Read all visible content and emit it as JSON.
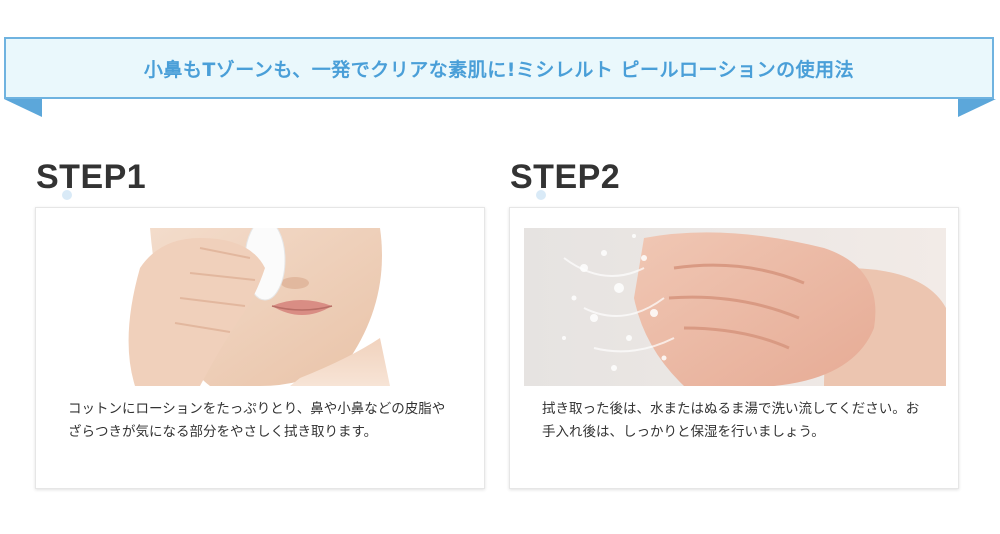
{
  "banner": {
    "title": "小鼻もTゾーンも、一発でクリアな素肌に!ミシレルト ピールローションの使用法"
  },
  "steps": [
    {
      "heading": "STEP1",
      "text": "コットンにローションをたっぷりとり、鼻や小鼻などの皮脂やざらつきが気になる部分をやさしく拭き取ります。",
      "image": "woman-applying-cotton-pad-photo"
    },
    {
      "heading": "STEP2",
      "text": "拭き取った後は、水またはぬるま湯で洗い流してください。お手入れ後は、しっかりと保湿を行いましょう。",
      "image": "face-splashing-water-photo"
    }
  ],
  "colors": {
    "banner_text": "#4a9fd8",
    "banner_bg": "#eaf8fc",
    "banner_border": "#6fb3e0",
    "heading": "#333333"
  }
}
